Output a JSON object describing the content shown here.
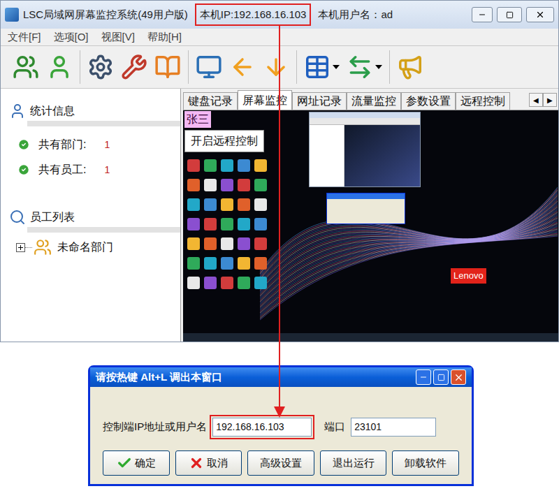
{
  "main_window": {
    "title": "LSC局域网屏幕监控系统(49用户版)",
    "local_ip": "本机IP:192.168.16.103",
    "local_user": "本机用户名：ad"
  },
  "menu": [
    "文件[F]",
    "选项[O]",
    "视图[V]",
    "帮助[H]"
  ],
  "sidebar": {
    "stats": {
      "title": "统计信息",
      "items": [
        {
          "label": "共有部门:",
          "value": "1"
        },
        {
          "label": "共有员工:",
          "value": "1"
        }
      ]
    },
    "employees": {
      "title": "员工列表",
      "tree": [
        {
          "label": "未命名部门",
          "expanded": false
        }
      ]
    }
  },
  "tabs": [
    {
      "label": "键盘记录",
      "selected": false
    },
    {
      "label": "屏幕监控",
      "selected": true
    },
    {
      "label": "网址记录",
      "selected": false
    },
    {
      "label": "流量监控",
      "selected": false
    },
    {
      "label": "参数设置",
      "selected": false
    },
    {
      "label": "远程控制",
      "selected": false
    }
  ],
  "tab_scroll": [
    "◀",
    "▶"
  ],
  "screen": {
    "user_label": "张三",
    "remote_button": "开启远程控制",
    "wallpaper_logo": "Lenovo"
  },
  "dialog": {
    "title": "请按热键 Alt+L 调出本窗口",
    "fields": [
      {
        "label": "控制端IP地址或用户名",
        "value": "192.168.16.103",
        "highlighted": true
      },
      {
        "label": "端口",
        "value": "23101",
        "highlighted": false
      }
    ],
    "buttons": [
      {
        "label": "确定",
        "kind": "confirm"
      },
      {
        "label": "取消",
        "kind": "cancel"
      },
      {
        "label": "高级设置",
        "kind": "plain"
      },
      {
        "label": "退出运行",
        "kind": "plain"
      },
      {
        "label": "卸载软件",
        "kind": "plain"
      }
    ]
  }
}
